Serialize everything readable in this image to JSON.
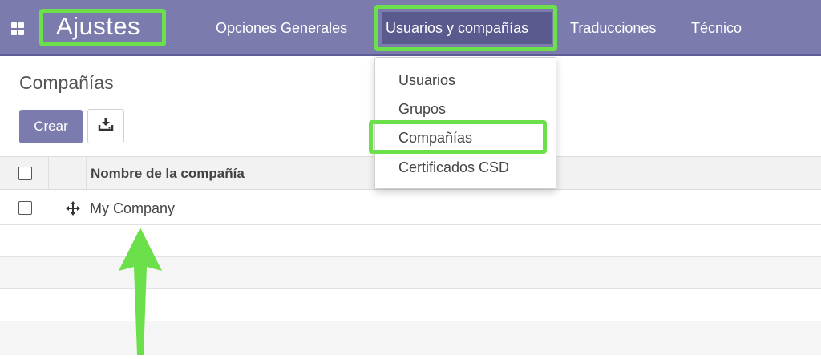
{
  "navbar": {
    "brand": "Ajustes",
    "menu": [
      {
        "label": "Opciones Generales"
      },
      {
        "label": "Usuarios y compañías"
      },
      {
        "label": "Traducciones"
      },
      {
        "label": "Técnico"
      }
    ],
    "apps_icon": "apps-grid-icon"
  },
  "dropdown": {
    "items": [
      {
        "label": "Usuarios"
      },
      {
        "label": "Grupos"
      },
      {
        "label": "Compañías"
      },
      {
        "label": "Certificados CSD"
      }
    ]
  },
  "control_panel": {
    "title": "Compañías",
    "create_label": "Crear",
    "download_icon": "download-icon"
  },
  "list": {
    "columns": [
      {
        "label": "Nombre de la compañía"
      }
    ],
    "rows": [
      {
        "name": "My Company"
      }
    ]
  },
  "colors": {
    "navbar": "#7c7bad",
    "navbar_active": "#5b5a8f",
    "highlight": "#6be04a",
    "primary_button": "#7c7bad"
  }
}
